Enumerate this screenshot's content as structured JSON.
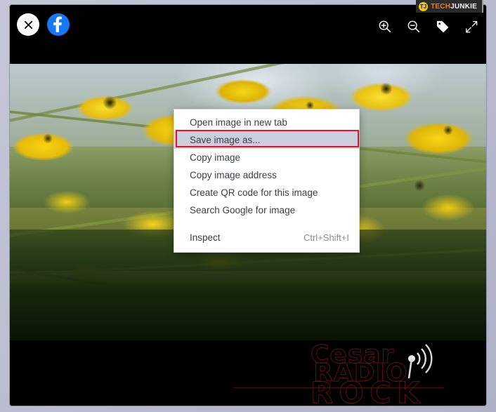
{
  "window": {
    "frame_color": "#b9bcd0",
    "background_color": "#000000"
  },
  "toolbar": {
    "left_buttons": [
      {
        "name": "close-button",
        "icon": "close-icon",
        "label": "Close"
      },
      {
        "name": "facebook-button",
        "icon": "facebook-icon",
        "label": "Facebook"
      }
    ],
    "right_buttons": [
      {
        "name": "zoom-in-button",
        "icon": "zoom-in-icon",
        "label": "Zoom in"
      },
      {
        "name": "zoom-out-button",
        "icon": "zoom-out-icon",
        "label": "Zoom out"
      },
      {
        "name": "tag-button",
        "icon": "tag-icon",
        "label": "Tag photo"
      },
      {
        "name": "expand-button",
        "icon": "expand-icon",
        "label": "Enter fullscreen"
      }
    ]
  },
  "context_menu": {
    "items": [
      {
        "label": "Open image in new tab",
        "accel": "",
        "highlighted": false
      },
      {
        "label": "Save image as...",
        "accel": "",
        "highlighted": true
      },
      {
        "label": "Copy image",
        "accel": "",
        "highlighted": false
      },
      {
        "label": "Copy image address",
        "accel": "",
        "highlighted": false
      },
      {
        "label": "Create QR code for this image",
        "accel": "",
        "highlighted": false
      },
      {
        "label": "Search Google for image",
        "accel": "",
        "highlighted": false
      },
      {
        "label": "Inspect",
        "accel": "Ctrl+Shift+I",
        "highlighted": false
      }
    ],
    "highlight_outline_color": "#e8112d",
    "highlight_fill_color": "#ccd0de"
  },
  "photo_watermark": {
    "line1": "Cesar",
    "line2": "RADIO",
    "line3": "ROCK",
    "color": "#5d1414",
    "icon": "radio-waves-icon"
  },
  "site_badge": {
    "mark": "TJ",
    "part1": "TECH",
    "part2": "JUNKIE",
    "mark_color": "#f5c518",
    "part1_color": "#f07d18",
    "part2_color": "#ffffff"
  }
}
